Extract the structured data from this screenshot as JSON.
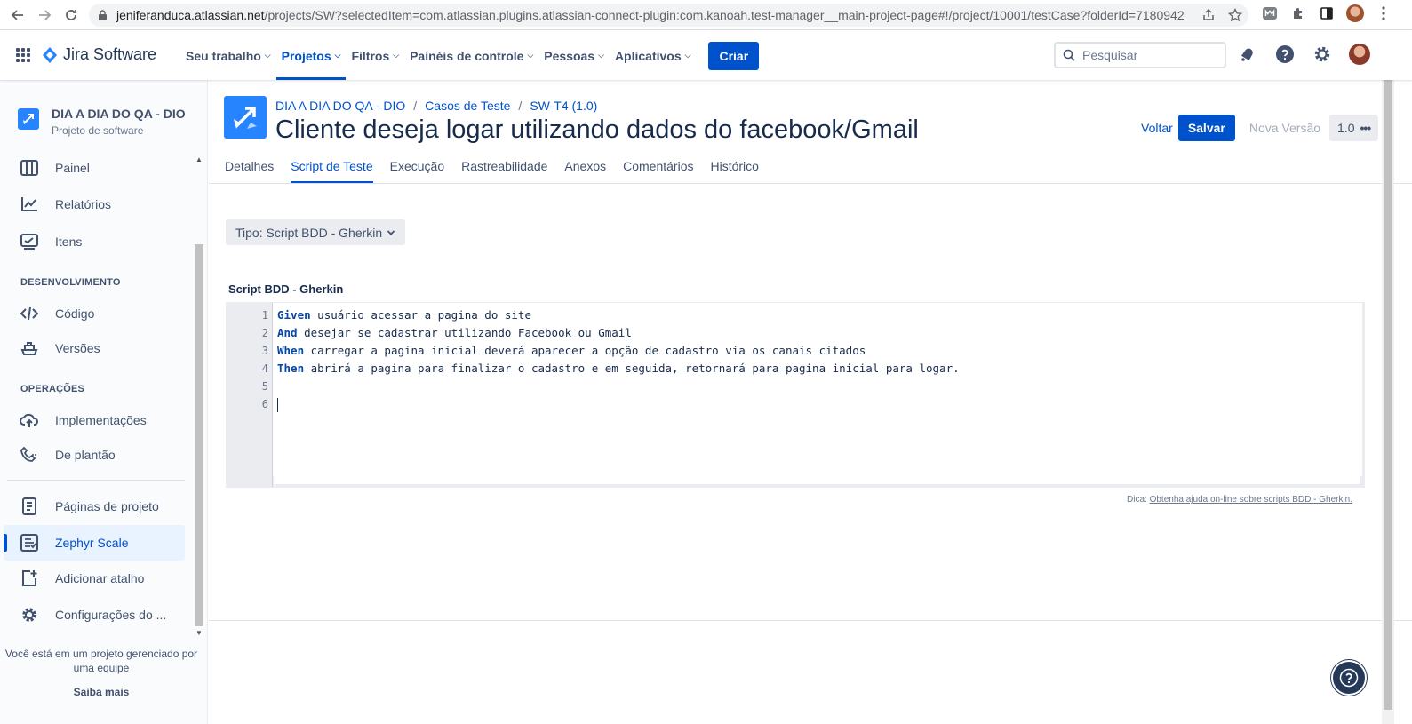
{
  "browser": {
    "url_host": "jeniferanduca.atlassian.net",
    "url_rest": "/projects/SW?selectedItem=com.atlassian.plugins.atlassian-connect-plugin:com.kanoah.test-manager__main-project-page#!/project/10001/testCase?folderId=7180942"
  },
  "topnav": {
    "product": "Jira Software",
    "menu": [
      {
        "label": "Seu trabalho"
      },
      {
        "label": "Projetos"
      },
      {
        "label": "Filtros"
      },
      {
        "label": "Painéis de controle"
      },
      {
        "label": "Pessoas"
      },
      {
        "label": "Aplicativos"
      }
    ],
    "create_label": "Criar",
    "search_placeholder": "Pesquisar"
  },
  "sidebar": {
    "project_name": "DIA A DIA DO QA - DIO",
    "project_type": "Projeto de software",
    "items": [
      {
        "label": "Painel",
        "icon": "board-icon"
      },
      {
        "label": "Relatórios",
        "icon": "chart-icon"
      },
      {
        "label": "Itens",
        "icon": "issues-icon"
      }
    ],
    "dev_header": "DESENVOLVIMENTO",
    "dev_items": [
      {
        "label": "Código",
        "icon": "code-icon"
      },
      {
        "label": "Versões",
        "icon": "ship-icon"
      }
    ],
    "ops_header": "OPERAÇÕES",
    "ops_items": [
      {
        "label": "Implementações",
        "icon": "cloud-upload-icon"
      },
      {
        "label": "De plantão",
        "icon": "phone-icon"
      }
    ],
    "extra_items": [
      {
        "label": "Páginas de projeto",
        "icon": "page-icon"
      },
      {
        "label": "Zephyr Scale",
        "icon": "zephyr-icon"
      },
      {
        "label": "Adicionar atalho",
        "icon": "add-shortcut-icon"
      },
      {
        "label": "Configurações do ...",
        "icon": "gear-icon"
      }
    ],
    "footer_text": "Você está em um projeto gerenciado por uma equipe",
    "footer_link": "Saiba mais"
  },
  "header": {
    "breadcrumbs": [
      "DIA A DIA DO QA - DIO",
      "Casos de Teste",
      "SW-T4 (1.0)"
    ],
    "title": "Cliente deseja logar utilizando dados do facebook/Gmail",
    "back_label": "Voltar",
    "save_label": "Salvar",
    "new_version_label": "Nova Versão",
    "version_label": "1.0",
    "tabs": [
      "Detalhes",
      "Script de Teste",
      "Execução",
      "Rastreabilidade",
      "Anexos",
      "Comentários",
      "Histórico"
    ],
    "active_tab": "Script de Teste"
  },
  "script": {
    "type_label": "Tipo: Script BDD - Gherkin",
    "section_title": "Script BDD - Gherkin",
    "lines": [
      {
        "num": "1",
        "keyword": "Given",
        "text": " usuário acessar a pagina do site"
      },
      {
        "num": "2",
        "keyword": "And",
        "text": " desejar se cadastrar utilizando Facebook ou Gmail"
      },
      {
        "num": "3",
        "keyword": "When",
        "text": " carregar a pagina inicial deverá aparecer a opção de cadastro via os canais citados"
      },
      {
        "num": "4",
        "keyword": "Then",
        "text": " abrirá a pagina para finalizar o cadastro e em seguida, retornará para pagina inicial para logar."
      },
      {
        "num": "5",
        "keyword": "",
        "text": ""
      },
      {
        "num": "6",
        "keyword": "",
        "text": ""
      }
    ],
    "hint_label": "Dica:",
    "hint_link": "Obtenha ajuda on-line sobre scripts BDD - Gherkin."
  },
  "colors": {
    "accent": "#0052cc",
    "keyword": "#0747a6",
    "sidebar_active_bg": "#e9f2ff"
  }
}
